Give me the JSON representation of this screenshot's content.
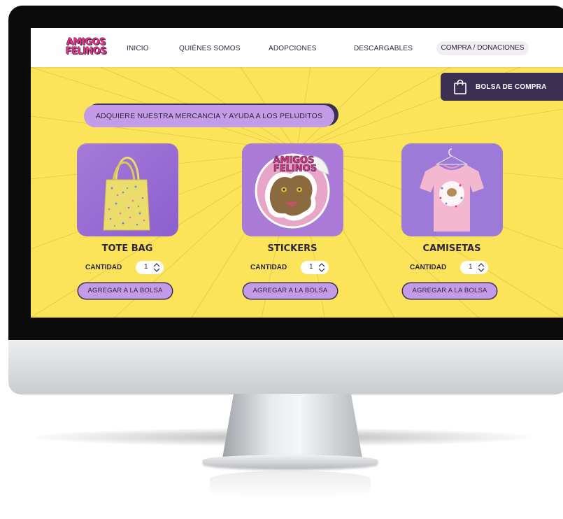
{
  "nav": {
    "logo_line1": "AMIGOS",
    "logo_line2": "FELINOS",
    "items": [
      {
        "label": "INICIO"
      },
      {
        "label": "QUIÉNES SOMOS"
      },
      {
        "label": "ADOPCIONES"
      },
      {
        "label": "DESCARGABLES"
      }
    ],
    "cta_label": "COMPRA / DONACIONES"
  },
  "shopping_bag_label": "BOLSA DE COMPRA",
  "banner_text": "ADQUIERE NUESTRA MERCANCIA Y AYUDA A LOS PELUDITOS",
  "products": [
    {
      "name": "TOTE BAG",
      "quantity_label": "CANTIDAD",
      "quantity": "1",
      "button_label": "AGREGAR A LA BOLSA"
    },
    {
      "name": "STICKERS",
      "quantity_label": "CANTIDAD",
      "quantity": "1",
      "button_label": "AGREGAR A LA BOLSA",
      "sticker_text_1": "AMIGOS",
      "sticker_text_2": "FELINOS"
    },
    {
      "name": "CAMISETAS",
      "quantity_label": "CANTIDAD",
      "quantity": "1",
      "button_label": "AGREGAR A LA BOLSA"
    }
  ],
  "colors": {
    "background": "#fbe35a",
    "accent_purple": "#c39be6",
    "dark_purple": "#3b2f52",
    "logo_pink": "#e6337a"
  }
}
